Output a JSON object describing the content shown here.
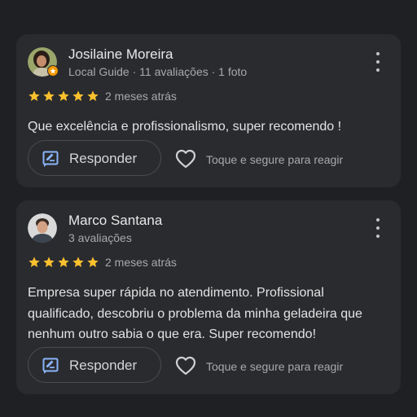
{
  "reviews": [
    {
      "author": "Josilaine Moreira",
      "meta": "Local Guide · 11 avaliações · 1 foto",
      "rating": 5,
      "time": "2 meses atrás",
      "text": "Que excelência e profissionalismo, super recomendo !",
      "reply_label": "Responder",
      "react_hint": "Toque e segure para reagir"
    },
    {
      "author": "Marco Santana",
      "meta": "3 avaliações",
      "rating": 5,
      "time": "2 meses atrás",
      "text": "Empresa super rápida no atendimento. Profissional qualificado, descobriu o problema da minha geladeira que nenhum outro sabia o que era. Super recomendo!",
      "reply_label": "Responder",
      "react_hint": "Toque e segure para reagir"
    }
  ],
  "icons": {
    "star": "star-icon",
    "reply": "reply-icon",
    "heart": "heart-outline-icon",
    "menu": "more-vertical-icon",
    "local_guide_badge": "local-guide-badge-icon"
  },
  "colors": {
    "background": "#1f2023",
    "card": "#2a2b2f",
    "star": "#fbc02d",
    "accent": "#8ab4f8",
    "local_guide_badge": "#f29900"
  }
}
